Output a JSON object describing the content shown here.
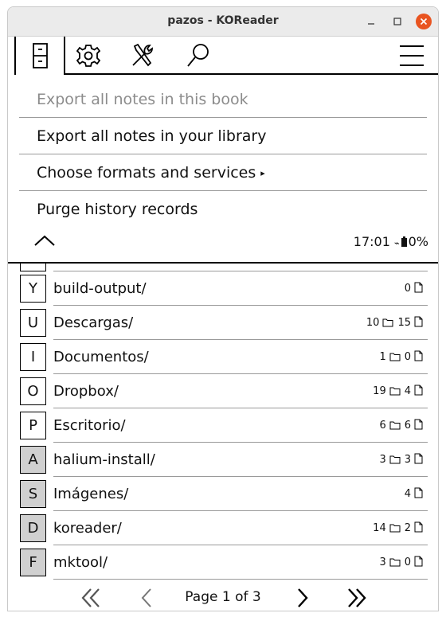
{
  "window": {
    "title": "pazos - KOReader"
  },
  "tabs": [
    {
      "name": "file-cabinet-icon",
      "active": true
    },
    {
      "name": "gear-icon",
      "active": false
    },
    {
      "name": "tools-icon",
      "active": false
    },
    {
      "name": "search-icon",
      "active": false
    },
    {
      "name": "hamburger-menu-icon",
      "active": false
    }
  ],
  "menu": {
    "items": [
      {
        "label": "Export all notes in this book",
        "enabled": false
      },
      {
        "label": "Export all notes in your library",
        "enabled": true
      },
      {
        "label": "Choose formats and services",
        "enabled": true,
        "submenu": "▸"
      },
      {
        "label": "Purge history records",
        "enabled": true
      }
    ]
  },
  "status": {
    "time": "17:01",
    "battery": "0%"
  },
  "files": [
    {
      "key": "Y",
      "name": "build-output/",
      "folders": null,
      "files": "0",
      "highlight": false
    },
    {
      "key": "U",
      "name": "Descargas/",
      "folders": "10",
      "files": "15",
      "highlight": false
    },
    {
      "key": "I",
      "name": "Documentos/",
      "folders": "1",
      "files": "0",
      "highlight": false
    },
    {
      "key": "O",
      "name": "Dropbox/",
      "folders": "19",
      "files": "4",
      "highlight": false
    },
    {
      "key": "P",
      "name": "Escritorio/",
      "folders": "6",
      "files": "6",
      "highlight": false
    },
    {
      "key": "A",
      "name": "halium-install/",
      "folders": "3",
      "files": "3",
      "highlight": true
    },
    {
      "key": "S",
      "name": "Imágenes/",
      "folders": null,
      "files": "4",
      "highlight": true
    },
    {
      "key": "D",
      "name": "koreader/",
      "folders": "14",
      "files": "2",
      "highlight": true
    },
    {
      "key": "F",
      "name": "mktool/",
      "folders": "3",
      "files": "0",
      "highlight": true
    }
  ],
  "pager": {
    "text": "Page 1 of 3"
  }
}
